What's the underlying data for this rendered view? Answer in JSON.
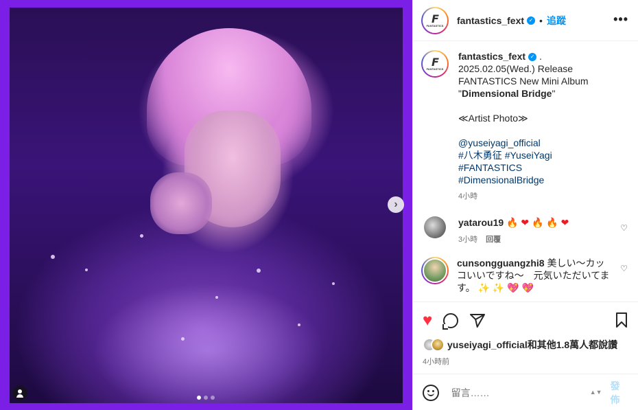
{
  "post": {
    "username": "fantastics_fext",
    "follow_label": "追蹤",
    "separator": "•",
    "more_label": "•••",
    "logo_letter": "F",
    "logo_sub": "FANTASTICS",
    "verified_mark": "✓"
  },
  "media": {
    "next_label": "›",
    "slide_count": 3,
    "active_slide": 1
  },
  "caption": {
    "username": "fantastics_fext",
    "after_name": ".",
    "line1": "2025.02.05(Wed.) Release",
    "line2": "FANTASTICS New Mini Album",
    "quote_open": "\"",
    "album_title": "Dimensional Bridge",
    "quote_close": "\"",
    "line4": "≪Artist Photo≫",
    "mention": "@yuseiyagi_official",
    "tag1": "#八木勇征",
    "tag2": "#YuseiYagi",
    "tag3": "#FANTASTICS",
    "tag4": "#DimensionalBridge",
    "time": "4小時"
  },
  "comments": [
    {
      "username": "yatarou19",
      "emojis": [
        "🔥",
        "❤",
        "🔥",
        "🔥",
        "❤"
      ],
      "time": "3小時",
      "reply_label": "回覆",
      "like_icon": "♡"
    },
    {
      "username": "cunsongguangzhi8",
      "text": "美しい～カッコいいですね～　元気いただいてます。",
      "emojis": [
        "✨",
        "✨",
        "💖",
        "💖"
      ],
      "like_icon": "♡"
    }
  ],
  "actions": {
    "like_icon": "♥",
    "liked_by_user": "yuseiyagi_official",
    "likes_text": "和其他1.8萬人都說讚",
    "post_time": "4小時前"
  },
  "add_comment": {
    "placeholder": "留言……",
    "updown": "▲▼",
    "post_label": "發佈"
  }
}
